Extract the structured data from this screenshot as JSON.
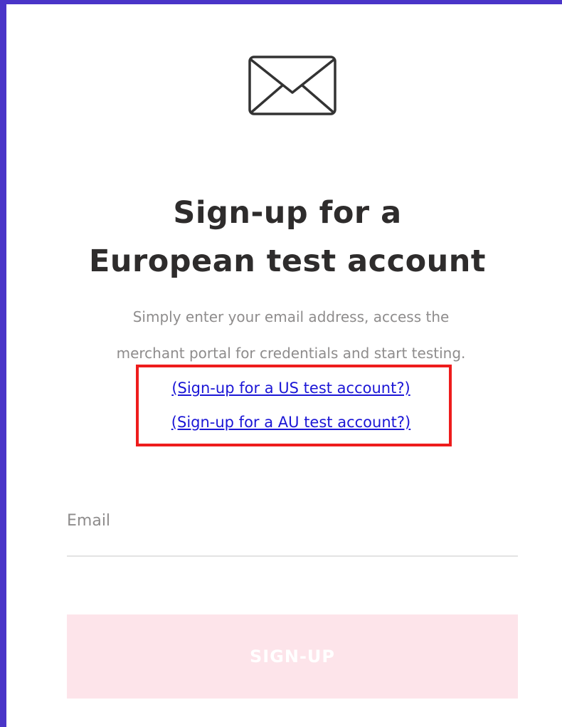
{
  "page": {
    "icon": "envelope-icon",
    "title_line1": "Sign-up for a",
    "title_line2": "European test account",
    "description_line1": "Simply enter your email address, access the",
    "description_line2": "merchant portal for credentials and start testing.",
    "us_link": "(Sign-up for a US test account?)",
    "au_link": "(Sign-up for a AU test account?)"
  },
  "form": {
    "email_label": "Email",
    "email_value": "",
    "submit_label": "SIGN-UP"
  },
  "colors": {
    "frame_border": "#4a35c8",
    "title": "#2e2c2c",
    "muted_text": "#8e8c8c",
    "link": "#1b16d6",
    "highlight_box": "#ee1c1c",
    "button_bg": "#fde4ea",
    "button_text": "#ffffff"
  }
}
